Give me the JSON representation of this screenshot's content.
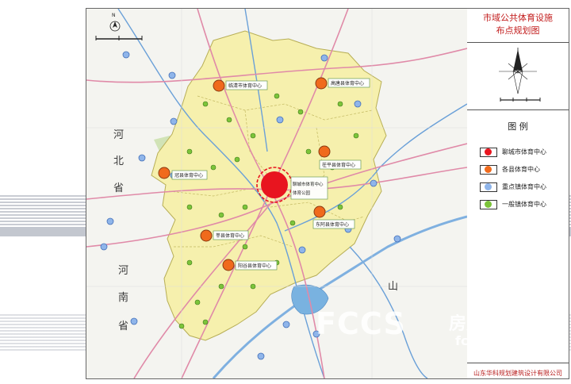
{
  "title": {
    "line1": "市域公共体育设施",
    "line2": "布点规划图"
  },
  "legend": {
    "heading": "图  例",
    "items": [
      {
        "label": "聊城市体育中心",
        "color": "#e8151f",
        "ring": "#e8151f"
      },
      {
        "label": "各县体育中心",
        "color": "#f06a1c",
        "ring": "#8a3a12"
      },
      {
        "label": "重点镇体育中心",
        "color": "#8fb5ea",
        "ring": "#4470b8"
      },
      {
        "label": "一般镇体育中心",
        "color": "#7cc43a",
        "ring": "#3f7a1a"
      }
    ]
  },
  "company": "山东华科规划建筑设计有限公司",
  "watermark": {
    "latin": "FCCS",
    "cn": "房产超市",
    "url": "fccs.com"
  },
  "map": {
    "compass_letter": "N",
    "region_labels": [
      {
        "text": "河",
        "role": "province-he-1"
      },
      {
        "text": "北",
        "role": "province-hebei-2"
      },
      {
        "text": "省",
        "role": "province-hebei-3"
      },
      {
        "text": "河",
        "role": "province-henan-1"
      },
      {
        "text": "南",
        "role": "province-henan-2"
      },
      {
        "text": "省",
        "role": "province-henan-3"
      },
      {
        "text": "山",
        "role": "province-shan"
      }
    ],
    "centers": [
      {
        "name": "聊城市体育中心",
        "sub": "体育公园",
        "tier": "city"
      },
      {
        "name": "临清市体育中心",
        "tier": "county"
      },
      {
        "name": "高唐县体育中心",
        "tier": "county"
      },
      {
        "name": "茌平县体育中心",
        "tier": "county"
      },
      {
        "name": "冠县体育中心",
        "tier": "county"
      },
      {
        "name": "东阿县体育中心",
        "tier": "county"
      },
      {
        "name": "莘县体育中心",
        "tier": "county"
      },
      {
        "name": "阳谷县体育中心",
        "tier": "county"
      }
    ]
  },
  "colors": {
    "region_fill": "#f5f0b0",
    "river": "#6aa0d8",
    "road_red": "#e08aa8",
    "lake": "#79b2e0",
    "forest": "#c8dfa8"
  }
}
